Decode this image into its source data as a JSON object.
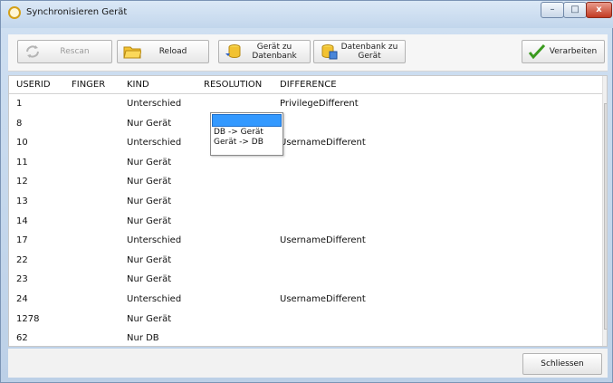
{
  "window": {
    "title": "Synchronisieren Gerät",
    "minimize": "–",
    "maximize": "□",
    "close": "x"
  },
  "toolbar": {
    "rescan": "Rescan",
    "reload": "Reload",
    "device_to_db": "Gerät zu\nDatenbank",
    "db_to_device": "Datenbank zu\nGerät",
    "process": "Verarbeiten"
  },
  "grid": {
    "columns": [
      "USERID",
      "FINGER",
      "KIND",
      "RESOLUTION",
      "DIFFERENCE"
    ],
    "rows": [
      {
        "userid": "1",
        "finger": "",
        "kind": "Unterschied",
        "resolution": "",
        "difference": "PrivilegeDifferent"
      },
      {
        "userid": "8",
        "finger": "",
        "kind": "Nur Gerät",
        "resolution": "",
        "difference": ""
      },
      {
        "userid": "10",
        "finger": "",
        "kind": "Unterschied",
        "resolution": "",
        "difference": "UsernameDifferent"
      },
      {
        "userid": "11",
        "finger": "",
        "kind": "Nur Gerät",
        "resolution": "",
        "difference": ""
      },
      {
        "userid": "12",
        "finger": "",
        "kind": "Nur Gerät",
        "resolution": "",
        "difference": ""
      },
      {
        "userid": "13",
        "finger": "",
        "kind": "Nur Gerät",
        "resolution": "",
        "difference": ""
      },
      {
        "userid": "14",
        "finger": "",
        "kind": "Nur Gerät",
        "resolution": "",
        "difference": ""
      },
      {
        "userid": "17",
        "finger": "",
        "kind": "Unterschied",
        "resolution": "",
        "difference": "UsernameDifferent"
      },
      {
        "userid": "22",
        "finger": "",
        "kind": "Nur Gerät",
        "resolution": "",
        "difference": ""
      },
      {
        "userid": "23",
        "finger": "",
        "kind": "Nur Gerät",
        "resolution": "",
        "difference": ""
      },
      {
        "userid": "24",
        "finger": "",
        "kind": "Unterschied",
        "resolution": "",
        "difference": "UsernameDifferent"
      },
      {
        "userid": "1278",
        "finger": "",
        "kind": "Nur Gerät",
        "resolution": "",
        "difference": ""
      },
      {
        "userid": "62",
        "finger": "",
        "kind": "Nur DB",
        "resolution": "",
        "difference": ""
      }
    ]
  },
  "resolution_dropdown": {
    "selected": "",
    "options": [
      "DB -> Gerät",
      "Gerät -> DB"
    ]
  },
  "footer": {
    "close": "Schliessen"
  }
}
